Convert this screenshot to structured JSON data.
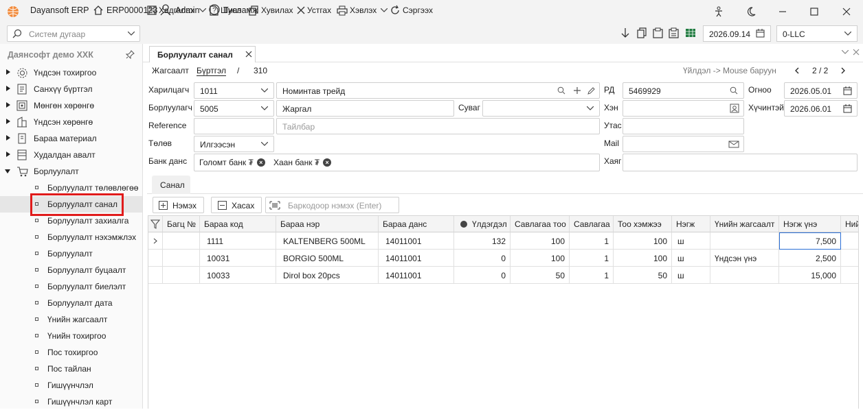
{
  "titlebar": {
    "app_name": "Dayansoft ERP",
    "company_code": "ERP0000123",
    "user": "Admin",
    "help": "Тусламж"
  },
  "toolbar": {
    "search_placeholder": "Систем дугаар",
    "save": "Хадгалах",
    "new": "Шинэ",
    "copy": "Хувилах",
    "delete": "Устгах",
    "print": "Хэвлэх",
    "refresh": "Сэргээх",
    "date": "2026.09.14",
    "company": "0-LLC"
  },
  "sidebar": {
    "header": "Даянсофт демо ХХК",
    "items": [
      {
        "label": "Үндсэн тохиргоо",
        "icon": "gear-icon"
      },
      {
        "label": "Санхүү бүртгэл",
        "icon": "ledger-icon"
      },
      {
        "label": "Мөнгөн хөрөнгө",
        "icon": "safe-icon"
      },
      {
        "label": "Үндсэн хөрөнгө",
        "icon": "building-icon"
      },
      {
        "label": "Бараа материал",
        "icon": "inventory-icon"
      },
      {
        "label": "Худалдан авалт",
        "icon": "purchase-icon"
      },
      {
        "label": "Борлуулалт",
        "icon": "cart-icon"
      }
    ],
    "subitems": [
      "Борлуулалт төлөвлөгөө",
      "Борлуулалт санал",
      "Борлуулалт захиалга",
      "Борлуулалт нэхэмжлэх",
      "Борлуулалт",
      "Борлуулалт буцаалт",
      "Борлуулалт биелэлт",
      "Борлуулалт дата",
      "Үнийн жагсаалт",
      "Үнийн тохиргоо",
      "Пос тохиргоо",
      "Пос тайлан",
      "Гишүүнчлэл",
      "Гишүүнчлэл карт"
    ]
  },
  "doc_tab": {
    "label": "Борлуулалт санал"
  },
  "form": {
    "crumb_list": "Жагсаалт",
    "crumb_register": "Бүртгэл",
    "crumb_sep": "/",
    "crumb_number": "310",
    "hint": "Үйлдэл -> Mouse баруун",
    "pager": "2 / 2",
    "customer_label": "Харилцагч",
    "customer_code": "1011",
    "customer_name": "Номинтав трейд",
    "seller_label": "Борлуулагч",
    "seller_code": "5005",
    "seller_name": "Жаргал",
    "branch_label": "Сувag",
    "reference_label": "Reference",
    "description_placeholder": "Тайлбар",
    "payment_label": "Төлөв",
    "payment_value": "Илгээсэн",
    "bank_label": "Банк данс",
    "bank_chips": [
      "Голомт банк ₮",
      "Хаан банк ₮"
    ],
    "rd_label": "РД",
    "rd_value": "5469929",
    "who_label": "Хэн",
    "phone_label": "Утас",
    "mail_label": "Mail",
    "address_label": "Хаяг",
    "date_label": "Огноо",
    "date_value": "2026.05.01",
    "valid_label": "Хүчинтэй",
    "valid_value": "2026.06.01"
  },
  "items_tab": {
    "label": "Санал"
  },
  "grid_buttons": {
    "add": "Нэмэх",
    "remove": "Хасах",
    "barcode_placeholder": "Баркодоор нэмэх (Enter)"
  },
  "grid": {
    "headers": [
      "Багц №",
      "Бараа код",
      "Бараа нэр",
      "Бараа данс",
      "Үлдэгдэл",
      "Савлагаа тоо",
      "Савлагаа",
      "Тоо хэмжээ",
      "Нэгж",
      "Үнийн жагсаалт",
      "Нэгж үнэ",
      "Нийт"
    ],
    "rows": [
      {
        "batch": "",
        "code": "1111",
        "name": "KALTENBERG 500ML",
        "account": "14011001",
        "stock": "132",
        "pack_qty": "100",
        "pack": "1",
        "qty": "100",
        "unit": "ш",
        "pricelist": "",
        "price": "7,500"
      },
      {
        "batch": "",
        "code": "10031",
        "name": "BORGIO 500ML",
        "account": "14011001",
        "stock": "0",
        "pack_qty": "100",
        "pack": "1",
        "qty": "100",
        "unit": "ш",
        "pricelist": "Үндсэн үнэ",
        "price": "2,500"
      },
      {
        "batch": "",
        "code": "10033",
        "name": "Dirol box 20pcs",
        "account": "14011001",
        "stock": "0",
        "pack_qty": "50",
        "pack": "1",
        "qty": "50",
        "unit": "ш",
        "pricelist": "",
        "price": "15,000"
      }
    ]
  }
}
